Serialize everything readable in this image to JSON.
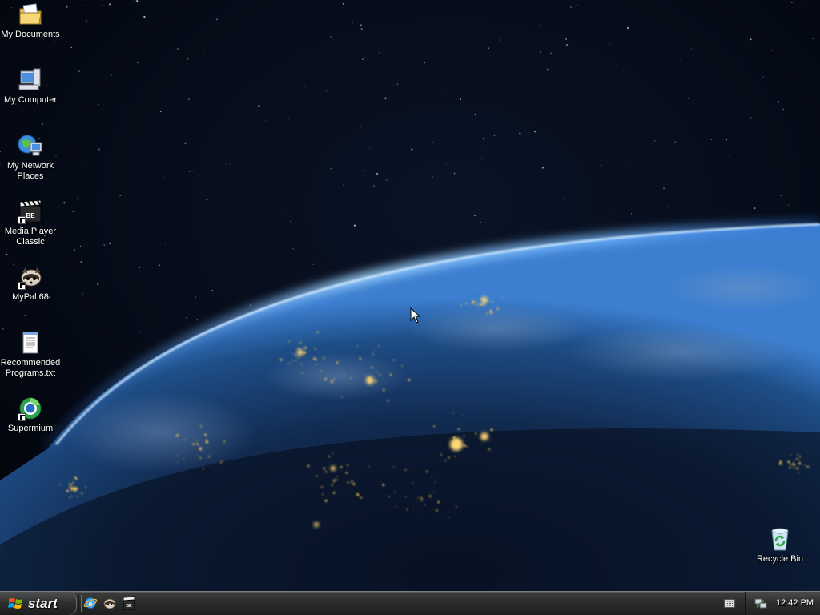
{
  "desktop": {
    "icons": [
      {
        "label": "My Documents",
        "icon": "my-documents-folder-icon"
      },
      {
        "label": "My Computer",
        "icon": "my-computer-icon"
      },
      {
        "label": "My Network\nPlaces",
        "icon": "network-places-icon"
      },
      {
        "label": "Media Player\nClassic",
        "icon": "media-player-classic-icon"
      },
      {
        "label": "MyPal 68",
        "icon": "mypal-icon"
      },
      {
        "label": "Recommended\nPrograms.txt",
        "icon": "text-file-icon"
      },
      {
        "label": "Supermium",
        "icon": "supermium-browser-icon"
      }
    ],
    "recycle_bin": {
      "label": "Recycle Bin",
      "icon": "recycle-bin-icon"
    },
    "wallpaper": "earth-from-space-night"
  },
  "taskbar": {
    "start_label": "start",
    "quick_launch": [
      "internet-explorer-icon",
      "mypal-icon",
      "media-player-classic-icon"
    ],
    "tray": {
      "clock": "12:42 PM",
      "icons": [
        "keyboard-icon",
        "network-connection-icon"
      ]
    }
  },
  "colors": {
    "taskbar": "#2a2b2b",
    "desktop_label": "#ffffff",
    "atmosphere": "#5aa8ff"
  }
}
